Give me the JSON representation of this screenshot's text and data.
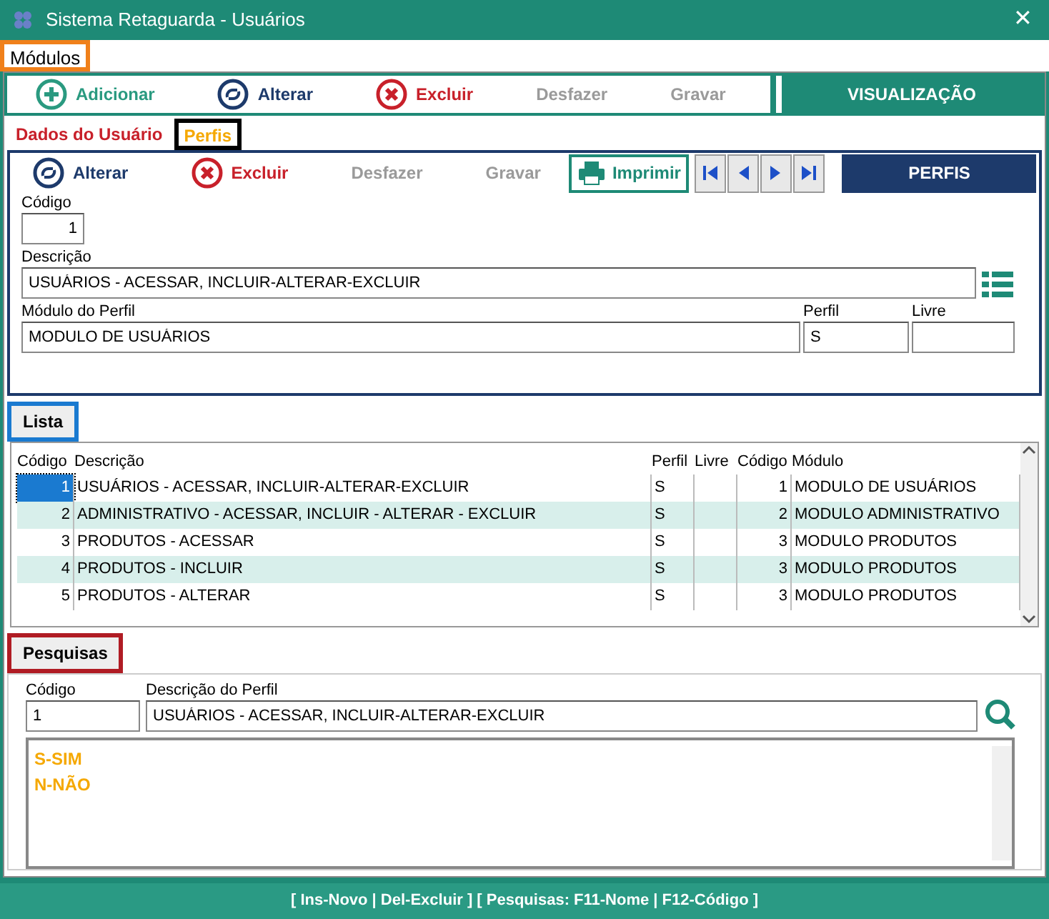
{
  "window": {
    "title": "Sistema Retaguarda - Usuários",
    "close": "✕"
  },
  "menu": [
    "Módulos"
  ],
  "toolbar": {
    "buttons": [
      {
        "label": "Adicionar",
        "kind": "add",
        "disabled": false
      },
      {
        "label": "Alterar",
        "kind": "edit",
        "disabled": false
      },
      {
        "label": "Excluir",
        "kind": "delete",
        "disabled": false
      },
      {
        "label": "Desfazer",
        "kind": "plain",
        "disabled": true
      },
      {
        "label": "Gravar",
        "kind": "plain",
        "disabled": true
      }
    ],
    "panel_title": "VISUALIZAÇÃO"
  },
  "tabs": [
    {
      "label": "Dados do Usuário",
      "selected": false
    },
    {
      "label": "Perfis",
      "selected": true
    }
  ],
  "profile_toolbar": {
    "buttons": [
      {
        "label": "Alterar",
        "kind": "edit",
        "disabled": false
      },
      {
        "label": "Excluir",
        "kind": "delete",
        "disabled": false
      },
      {
        "label": "Desfazer",
        "kind": "plain",
        "disabled": true
      },
      {
        "label": "Gravar",
        "kind": "plain",
        "disabled": true
      }
    ],
    "print": "Imprimir",
    "nav": [
      {
        "kind": "first"
      },
      {
        "kind": "prev"
      },
      {
        "kind": "next"
      },
      {
        "kind": "last"
      }
    ],
    "panel_title": "PERFIS"
  },
  "form": {
    "codigo": {
      "label": "Código",
      "value": "1"
    },
    "descricao": {
      "label": "Descrição",
      "value": "USUÁRIOS - ACESSAR, INCLUIR-ALTERAR-EXCLUIR"
    },
    "modulo": {
      "label": "Módulo do Perfil",
      "value": "MODULO DE USUÁRIOS"
    },
    "perfil": {
      "label": "Perfil",
      "value": "S"
    },
    "livre": {
      "label": "Livre"
    }
  },
  "lista": {
    "title": "Lista",
    "columns": [
      "Código",
      "Descrição",
      "Perfil",
      "Livre",
      "Código",
      "Módulo"
    ],
    "rows": [
      {
        "cells": [
          "1",
          "USUÁRIOS - ACESSAR, INCLUIR-ALTERAR-EXCLUIR",
          "S",
          "",
          "1",
          "MODULO DE USUÁRIOS"
        ],
        "selected": true
      },
      {
        "cells": [
          "2",
          "ADMINISTRATIVO - ACESSAR, INCLUIR - ALTERAR - EXCLUIR",
          "S",
          "",
          "2",
          "MODULO ADMINISTRATIVO"
        ],
        "selected": false
      },
      {
        "cells": [
          "3",
          "PRODUTOS - ACESSAR",
          "S",
          "",
          "3",
          "MODULO PRODUTOS"
        ],
        "selected": false
      },
      {
        "cells": [
          "4",
          "PRODUTOS - INCLUIR",
          "S",
          "",
          "3",
          "MODULO PRODUTOS"
        ],
        "selected": false
      },
      {
        "cells": [
          "5",
          "PRODUTOS - ALTERAR",
          "S",
          "",
          "3",
          "MODULO PRODUTOS"
        ],
        "selected": false
      }
    ]
  },
  "pesquisas": {
    "title": "Pesquisas",
    "codigo": {
      "label": "Código",
      "value": "1"
    },
    "descricao": {
      "label": "Descrição do Perfil",
      "value": "USUÁRIOS - ACESSAR, INCLUIR-ALTERAR-EXCLUIR"
    },
    "legend": [
      "S-SIM",
      "N-NÃO"
    ]
  },
  "status_bar": "[ Ins-Novo | Del-Excluir ] [ Pesquisas: F11-Nome | F12-Código ]"
}
